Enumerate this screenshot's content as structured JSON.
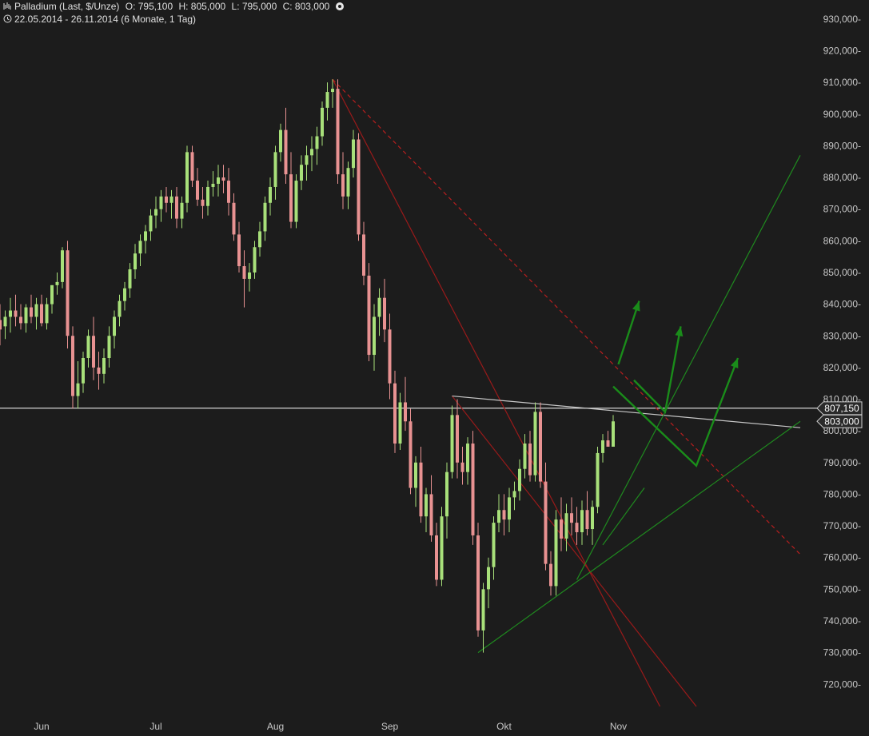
{
  "header": {
    "symbol": "Palladium (Last, $/Unze)",
    "open": "O: 795,100",
    "high": "H: 805,000",
    "low": "L: 795,000",
    "close": "C: 803,000",
    "range": "22.05.2014 - 26.11.2014 (6 Monate, 1 Tag)"
  },
  "chart_data": {
    "type": "candlestick",
    "ylim": [
      713,
      933
    ],
    "y_ticks": [
      930,
      920,
      910,
      900,
      890,
      880,
      870,
      860,
      850,
      840,
      830,
      820,
      810,
      800,
      790,
      780,
      770,
      760,
      750,
      740,
      730,
      720
    ],
    "y_tick_labels": [
      "930,000-",
      "920,000-",
      "910,000-",
      "900,000-",
      "890,000-",
      "880,000-",
      "870,000-",
      "860,000-",
      "850,000-",
      "840,000-",
      "830,000-",
      "820,000-",
      "810,000-",
      "800,000-",
      "790,000-",
      "780,000-",
      "770,000-",
      "760,000-",
      "750,000-",
      "740,000-",
      "730,000-",
      "720,000-"
    ],
    "x_labels": [
      {
        "label": "Jun",
        "day": 8
      },
      {
        "label": "Jul",
        "day": 30
      },
      {
        "label": "Aug",
        "day": 53
      },
      {
        "label": "Sep",
        "day": 75
      },
      {
        "label": "Okt",
        "day": 97
      },
      {
        "label": "Nov",
        "day": 119
      }
    ],
    "horizontal_line": 807.15,
    "price_labels": [
      {
        "label": "807,150",
        "value": 807.15
      },
      {
        "label": "803,000",
        "value": 803.0
      }
    ],
    "up_color": "#a8e07a",
    "down_color": "#e89292",
    "candles": [
      {
        "d": 0,
        "o": 835,
        "h": 840,
        "l": 827,
        "c": 832
      },
      {
        "d": 1,
        "o": 833,
        "h": 838,
        "l": 829,
        "c": 836
      },
      {
        "d": 2,
        "o": 836,
        "h": 842,
        "l": 831,
        "c": 838
      },
      {
        "d": 3,
        "o": 838,
        "h": 843,
        "l": 833,
        "c": 836
      },
      {
        "d": 4,
        "o": 836,
        "h": 840,
        "l": 832,
        "c": 834
      },
      {
        "d": 5,
        "o": 834,
        "h": 840,
        "l": 831,
        "c": 839
      },
      {
        "d": 6,
        "o": 839,
        "h": 843,
        "l": 834,
        "c": 836
      },
      {
        "d": 7,
        "o": 836,
        "h": 842,
        "l": 832,
        "c": 840
      },
      {
        "d": 8,
        "o": 840,
        "h": 843,
        "l": 833,
        "c": 834
      },
      {
        "d": 9,
        "o": 834,
        "h": 842,
        "l": 832,
        "c": 840
      },
      {
        "d": 10,
        "o": 840,
        "h": 846,
        "l": 837,
        "c": 846
      },
      {
        "d": 11,
        "o": 846,
        "h": 850,
        "l": 843,
        "c": 847
      },
      {
        "d": 12,
        "o": 847,
        "h": 858,
        "l": 845,
        "c": 857
      },
      {
        "d": 13,
        "o": 857,
        "h": 860,
        "l": 826,
        "c": 830
      },
      {
        "d": 14,
        "o": 830,
        "h": 833,
        "l": 807,
        "c": 811
      },
      {
        "d": 15,
        "o": 811,
        "h": 822,
        "l": 807,
        "c": 815
      },
      {
        "d": 16,
        "o": 815,
        "h": 825,
        "l": 812,
        "c": 823
      },
      {
        "d": 17,
        "o": 823,
        "h": 832,
        "l": 820,
        "c": 830
      },
      {
        "d": 18,
        "o": 830,
        "h": 836,
        "l": 816,
        "c": 820
      },
      {
        "d": 19,
        "o": 820,
        "h": 825,
        "l": 813,
        "c": 818
      },
      {
        "d": 20,
        "o": 818,
        "h": 826,
        "l": 815,
        "c": 823
      },
      {
        "d": 21,
        "o": 823,
        "h": 833,
        "l": 820,
        "c": 830
      },
      {
        "d": 22,
        "o": 830,
        "h": 838,
        "l": 826,
        "c": 836
      },
      {
        "d": 23,
        "o": 836,
        "h": 843,
        "l": 833,
        "c": 841
      },
      {
        "d": 24,
        "o": 841,
        "h": 847,
        "l": 838,
        "c": 845
      },
      {
        "d": 25,
        "o": 845,
        "h": 853,
        "l": 842,
        "c": 851
      },
      {
        "d": 26,
        "o": 851,
        "h": 859,
        "l": 848,
        "c": 856
      },
      {
        "d": 27,
        "o": 856,
        "h": 862,
        "l": 852,
        "c": 860
      },
      {
        "d": 28,
        "o": 860,
        "h": 865,
        "l": 856,
        "c": 863
      },
      {
        "d": 29,
        "o": 863,
        "h": 870,
        "l": 860,
        "c": 868
      },
      {
        "d": 30,
        "o": 868,
        "h": 874,
        "l": 864,
        "c": 870
      },
      {
        "d": 31,
        "o": 870,
        "h": 876,
        "l": 866,
        "c": 874
      },
      {
        "d": 32,
        "o": 874,
        "h": 877,
        "l": 869,
        "c": 872
      },
      {
        "d": 33,
        "o": 872,
        "h": 876,
        "l": 867,
        "c": 874
      },
      {
        "d": 34,
        "o": 874,
        "h": 877,
        "l": 864,
        "c": 867
      },
      {
        "d": 35,
        "o": 867,
        "h": 874,
        "l": 864,
        "c": 872
      },
      {
        "d": 36,
        "o": 872,
        "h": 890,
        "l": 869,
        "c": 888
      },
      {
        "d": 37,
        "o": 888,
        "h": 890,
        "l": 877,
        "c": 879
      },
      {
        "d": 38,
        "o": 879,
        "h": 883,
        "l": 871,
        "c": 873
      },
      {
        "d": 39,
        "o": 873,
        "h": 877,
        "l": 867,
        "c": 871
      },
      {
        "d": 40,
        "o": 871,
        "h": 879,
        "l": 868,
        "c": 877
      },
      {
        "d": 41,
        "o": 877,
        "h": 882,
        "l": 874,
        "c": 878
      },
      {
        "d": 42,
        "o": 878,
        "h": 884,
        "l": 874,
        "c": 880
      },
      {
        "d": 43,
        "o": 880,
        "h": 884,
        "l": 875,
        "c": 879
      },
      {
        "d": 44,
        "o": 879,
        "h": 883,
        "l": 868,
        "c": 872
      },
      {
        "d": 45,
        "o": 872,
        "h": 875,
        "l": 860,
        "c": 862
      },
      {
        "d": 46,
        "o": 862,
        "h": 866,
        "l": 850,
        "c": 852
      },
      {
        "d": 47,
        "o": 852,
        "h": 857,
        "l": 839,
        "c": 848
      },
      {
        "d": 48,
        "o": 848,
        "h": 853,
        "l": 844,
        "c": 850
      },
      {
        "d": 49,
        "o": 850,
        "h": 860,
        "l": 848,
        "c": 858
      },
      {
        "d": 50,
        "o": 858,
        "h": 866,
        "l": 855,
        "c": 863
      },
      {
        "d": 51,
        "o": 863,
        "h": 874,
        "l": 860,
        "c": 872
      },
      {
        "d": 52,
        "o": 872,
        "h": 880,
        "l": 868,
        "c": 877
      },
      {
        "d": 53,
        "o": 877,
        "h": 890,
        "l": 873,
        "c": 888
      },
      {
        "d": 54,
        "o": 888,
        "h": 897,
        "l": 885,
        "c": 895
      },
      {
        "d": 55,
        "o": 895,
        "h": 902,
        "l": 878,
        "c": 881
      },
      {
        "d": 56,
        "o": 881,
        "h": 888,
        "l": 864,
        "c": 866
      },
      {
        "d": 57,
        "o": 866,
        "h": 881,
        "l": 864,
        "c": 879
      },
      {
        "d": 58,
        "o": 879,
        "h": 887,
        "l": 876,
        "c": 884
      },
      {
        "d": 59,
        "o": 884,
        "h": 890,
        "l": 879,
        "c": 887
      },
      {
        "d": 60,
        "o": 887,
        "h": 893,
        "l": 882,
        "c": 889
      },
      {
        "d": 61,
        "o": 889,
        "h": 896,
        "l": 884,
        "c": 893
      },
      {
        "d": 62,
        "o": 893,
        "h": 904,
        "l": 890,
        "c": 902
      },
      {
        "d": 63,
        "o": 902,
        "h": 910,
        "l": 898,
        "c": 907
      },
      {
        "d": 64,
        "o": 907,
        "h": 911,
        "l": 902,
        "c": 908
      },
      {
        "d": 65,
        "o": 908,
        "h": 911,
        "l": 878,
        "c": 881
      },
      {
        "d": 66,
        "o": 881,
        "h": 888,
        "l": 870,
        "c": 874
      },
      {
        "d": 67,
        "o": 874,
        "h": 885,
        "l": 870,
        "c": 883
      },
      {
        "d": 68,
        "o": 883,
        "h": 895,
        "l": 880,
        "c": 892
      },
      {
        "d": 69,
        "o": 892,
        "h": 894,
        "l": 860,
        "c": 862
      },
      {
        "d": 70,
        "o": 862,
        "h": 866,
        "l": 846,
        "c": 849
      },
      {
        "d": 71,
        "o": 849,
        "h": 853,
        "l": 822,
        "c": 824
      },
      {
        "d": 72,
        "o": 824,
        "h": 840,
        "l": 819,
        "c": 836
      },
      {
        "d": 73,
        "o": 836,
        "h": 845,
        "l": 830,
        "c": 842
      },
      {
        "d": 74,
        "o": 842,
        "h": 848,
        "l": 828,
        "c": 832
      },
      {
        "d": 75,
        "o": 832,
        "h": 837,
        "l": 810,
        "c": 815
      },
      {
        "d": 76,
        "o": 815,
        "h": 819,
        "l": 793,
        "c": 796
      },
      {
        "d": 77,
        "o": 796,
        "h": 812,
        "l": 794,
        "c": 809
      },
      {
        "d": 78,
        "o": 809,
        "h": 817,
        "l": 800,
        "c": 803
      },
      {
        "d": 79,
        "o": 803,
        "h": 807,
        "l": 780,
        "c": 782
      },
      {
        "d": 80,
        "o": 782,
        "h": 792,
        "l": 776,
        "c": 790
      },
      {
        "d": 81,
        "o": 790,
        "h": 795,
        "l": 771,
        "c": 773
      },
      {
        "d": 82,
        "o": 773,
        "h": 782,
        "l": 768,
        "c": 780
      },
      {
        "d": 83,
        "o": 780,
        "h": 786,
        "l": 765,
        "c": 767
      },
      {
        "d": 84,
        "o": 767,
        "h": 771,
        "l": 751,
        "c": 753
      },
      {
        "d": 85,
        "o": 753,
        "h": 776,
        "l": 751,
        "c": 773
      },
      {
        "d": 86,
        "o": 773,
        "h": 790,
        "l": 766,
        "c": 787
      },
      {
        "d": 87,
        "o": 787,
        "h": 808,
        "l": 785,
        "c": 805
      },
      {
        "d": 88,
        "o": 805,
        "h": 810,
        "l": 785,
        "c": 790
      },
      {
        "d": 89,
        "o": 790,
        "h": 795,
        "l": 783,
        "c": 787
      },
      {
        "d": 90,
        "o": 787,
        "h": 798,
        "l": 783,
        "c": 796
      },
      {
        "d": 91,
        "o": 796,
        "h": 800,
        "l": 764,
        "c": 767
      },
      {
        "d": 92,
        "o": 767,
        "h": 771,
        "l": 735,
        "c": 737
      },
      {
        "d": 93,
        "o": 737,
        "h": 752,
        "l": 730,
        "c": 750
      },
      {
        "d": 94,
        "o": 750,
        "h": 760,
        "l": 744,
        "c": 757
      },
      {
        "d": 95,
        "o": 757,
        "h": 773,
        "l": 753,
        "c": 771
      },
      {
        "d": 96,
        "o": 771,
        "h": 780,
        "l": 768,
        "c": 775
      },
      {
        "d": 97,
        "o": 775,
        "h": 780,
        "l": 767,
        "c": 772
      },
      {
        "d": 98,
        "o": 772,
        "h": 782,
        "l": 768,
        "c": 779
      },
      {
        "d": 99,
        "o": 779,
        "h": 784,
        "l": 775,
        "c": 781
      },
      {
        "d": 100,
        "o": 781,
        "h": 791,
        "l": 778,
        "c": 788
      },
      {
        "d": 101,
        "o": 788,
        "h": 799,
        "l": 785,
        "c": 796
      },
      {
        "d": 102,
        "o": 796,
        "h": 800,
        "l": 784,
        "c": 786
      },
      {
        "d": 103,
        "o": 786,
        "h": 809,
        "l": 784,
        "c": 806
      },
      {
        "d": 104,
        "o": 806,
        "h": 809,
        "l": 782,
        "c": 784
      },
      {
        "d": 105,
        "o": 784,
        "h": 790,
        "l": 756,
        "c": 758
      },
      {
        "d": 106,
        "o": 758,
        "h": 762,
        "l": 748,
        "c": 751
      },
      {
        "d": 107,
        "o": 751,
        "h": 775,
        "l": 748,
        "c": 772
      },
      {
        "d": 108,
        "o": 772,
        "h": 779,
        "l": 762,
        "c": 766
      },
      {
        "d": 109,
        "o": 766,
        "h": 777,
        "l": 762,
        "c": 774
      },
      {
        "d": 110,
        "o": 774,
        "h": 779,
        "l": 767,
        "c": 771
      },
      {
        "d": 111,
        "o": 771,
        "h": 776,
        "l": 764,
        "c": 768
      },
      {
        "d": 112,
        "o": 768,
        "h": 778,
        "l": 764,
        "c": 775
      },
      {
        "d": 113,
        "o": 775,
        "h": 781,
        "l": 767,
        "c": 769
      },
      {
        "d": 114,
        "o": 769,
        "h": 778,
        "l": 764,
        "c": 776
      },
      {
        "d": 115,
        "o": 776,
        "h": 795,
        "l": 774,
        "c": 793
      },
      {
        "d": 116,
        "o": 793,
        "h": 799,
        "l": 790,
        "c": 797
      },
      {
        "d": 117,
        "o": 797,
        "h": 800,
        "l": 795,
        "c": 795
      },
      {
        "d": 118,
        "o": 795,
        "h": 805,
        "l": 795,
        "c": 803
      }
    ],
    "lines": [
      {
        "color": "#9a1a1a",
        "dash": false,
        "points": [
          [
            64,
            911
          ],
          [
            127,
            713
          ]
        ]
      },
      {
        "color": "#9a1a1a",
        "dash": false,
        "points": [
          [
            87,
            811
          ],
          [
            134,
            713
          ]
        ]
      },
      {
        "color": "#b81e1e",
        "dash": true,
        "points": [
          [
            64,
            911
          ],
          [
            154,
            761
          ]
        ]
      },
      {
        "color": "#c8c8c8",
        "dash": false,
        "points": [
          [
            87,
            811
          ],
          [
            154,
            801
          ]
        ]
      },
      {
        "color": "#1f8a1f",
        "dash": false,
        "points": [
          [
            92,
            730
          ],
          [
            154,
            803
          ]
        ]
      },
      {
        "color": "#1f8a1f",
        "dash": false,
        "points": [
          [
            111,
            753
          ],
          [
            154,
            887
          ]
        ]
      },
      {
        "color": "#1f8a1f",
        "dash": false,
        "points": [
          [
            116,
            764
          ],
          [
            124,
            782
          ]
        ]
      }
    ],
    "projection_arrows": [
      {
        "color": "#1a8c1a",
        "points": [
          [
            119,
            821
          ],
          [
            123,
            841
          ]
        ]
      },
      {
        "color": "#1a8c1a",
        "points": [
          [
            122,
            816
          ],
          [
            128,
            806
          ],
          [
            131,
            833
          ]
        ]
      },
      {
        "color": "#1a8c1a",
        "points": [
          [
            118,
            814
          ],
          [
            134,
            789
          ],
          [
            142,
            823
          ]
        ]
      }
    ]
  }
}
